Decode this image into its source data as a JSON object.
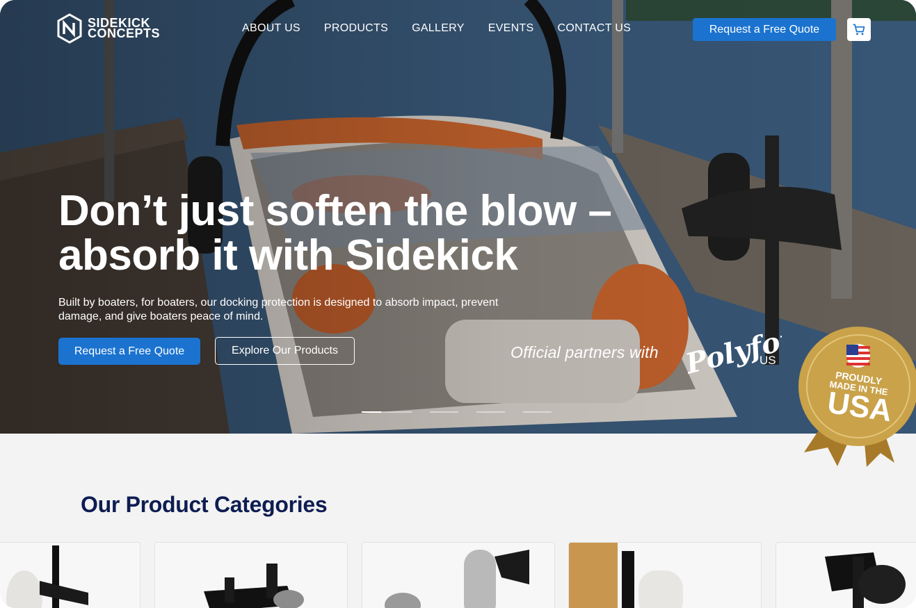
{
  "brand": {
    "name_line1": "SIDEKICK",
    "name_line2": "CONCEPTS",
    "logo_icon": "sidekick-logo-icon"
  },
  "nav": {
    "items": [
      {
        "label": "ABOUT US"
      },
      {
        "label": "PRODUCTS"
      },
      {
        "label": "GALLERY"
      },
      {
        "label": "EVENTS"
      },
      {
        "label": "CONTACT US"
      }
    ],
    "quote_label": "Request a Free Quote",
    "cart_icon": "cart-icon"
  },
  "hero": {
    "headline_line1": "Don’t just soften the blow –",
    "headline_line2": "absorb it with Sidekick",
    "subtext": "Built by boaters, for boaters, our docking protection is designed to absorb impact, prevent damage, and give boaters peace of mind.",
    "primary_cta": "Request a Free Quote",
    "secondary_cta": "Explore Our Products",
    "partners_text": "Official partners with",
    "partner_logo": "Polyform",
    "partner_logo_suffix": "US",
    "slides_total": 5,
    "slide_active": 1
  },
  "badge": {
    "line1": "PROUDLY",
    "line2": "MADE IN THE",
    "line3": "USA",
    "flag_icon": "us-flag-icon"
  },
  "categories": {
    "title": "Our Product Categories"
  },
  "colors": {
    "accent": "#1b73cf",
    "heading": "#0e1d52",
    "badge_gold": "#c9a24a"
  }
}
